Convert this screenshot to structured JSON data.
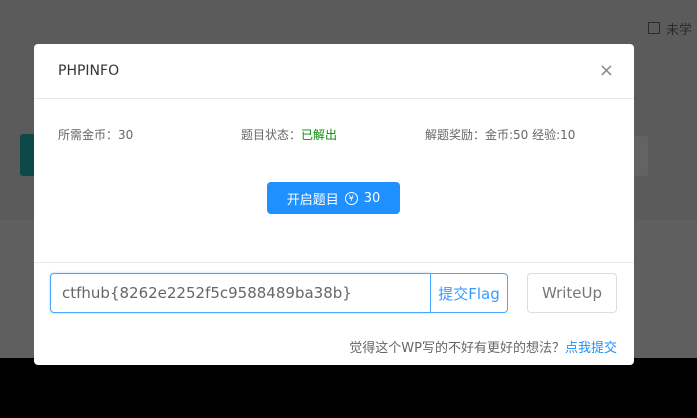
{
  "background": {
    "checkbox_label": "未学"
  },
  "modal": {
    "title": "PHPINFO",
    "close": "×",
    "required_coins": "所需金币：30",
    "status_label": "题目状态：",
    "status_value": "已解出",
    "reward": "解题奖励：金币:50 经验:10",
    "start_button": "开启题目",
    "start_coin_icon": "¥",
    "start_cost": "30",
    "flag_value": "ctfhub{8262e2252f5c9588489ba38b}",
    "submit_label": "提交Flag",
    "writeup_label": "WriteUp",
    "feedback_text": "觉得这个WP写的不好有更好的想法？",
    "feedback_link": "点我提交"
  },
  "colors": {
    "accent": "#1e90ff",
    "solved": "#0a8a0a"
  }
}
